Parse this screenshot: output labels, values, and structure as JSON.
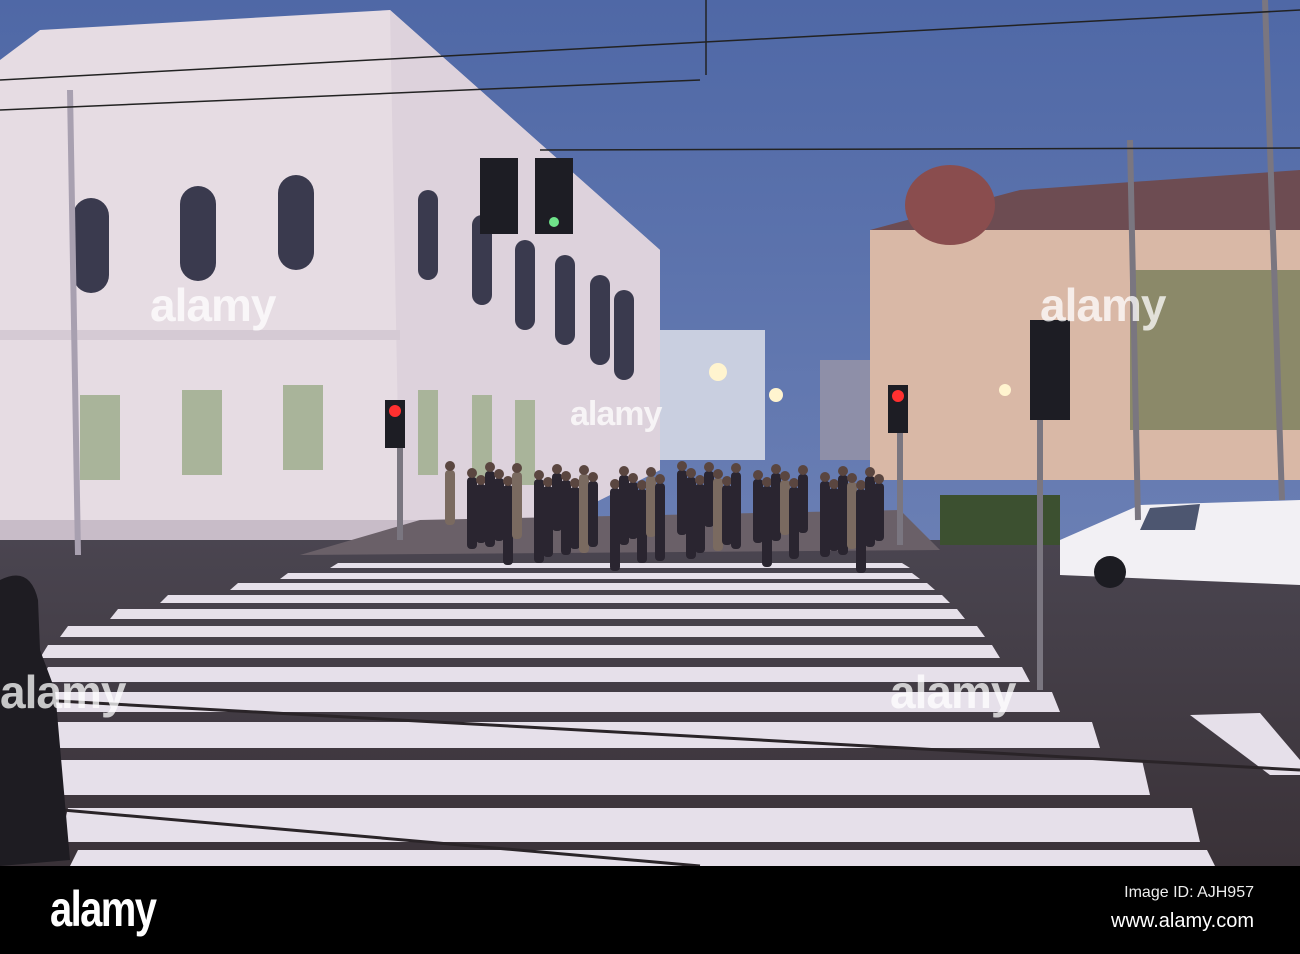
{
  "photo": {
    "subject": "Pedestrian crossing at dusk",
    "sky_color": "#5f79b0",
    "building_color": "#e8dde4",
    "crosswalk_color": "#e6e0ea"
  },
  "watermark": {
    "text": "alamy"
  },
  "footer": {
    "logo": "alamy",
    "image_id": "Image ID: AJH957",
    "website": "www.alamy.com"
  }
}
